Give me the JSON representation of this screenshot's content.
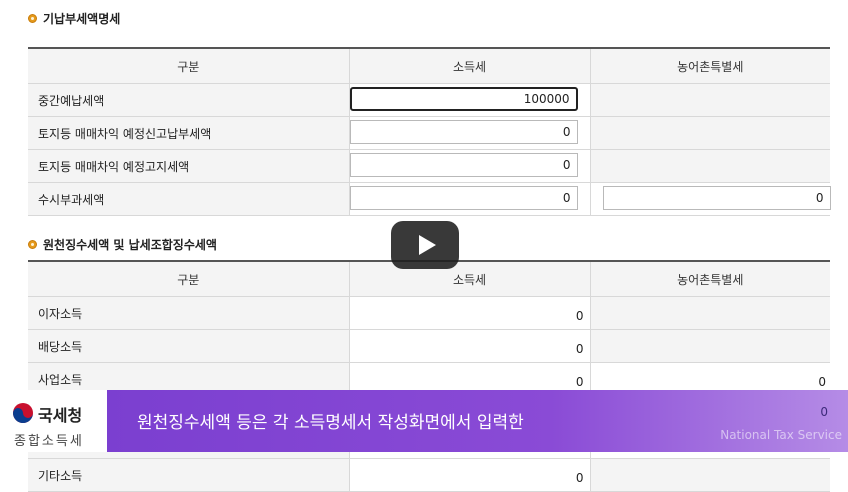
{
  "section1": {
    "title": "기납부세액명세",
    "headers": [
      "구분",
      "소득세",
      "농어촌특별세"
    ],
    "rows": [
      {
        "label": "중간예납세액",
        "income_tax": "100000"
      },
      {
        "label": "토지등 매매차익 예정신고납부세액",
        "income_tax": "0"
      },
      {
        "label": "토지등 매매차익 예정고지세액",
        "income_tax": "0"
      },
      {
        "label": "수시부과세액",
        "income_tax": "0",
        "rural_tax": "0"
      }
    ]
  },
  "section2": {
    "title": "원천징수세액 및 납세조합징수세액",
    "headers": [
      "구분",
      "소득세",
      "농어촌특별세"
    ],
    "rows": [
      {
        "label": "이자소득",
        "income_tax": "0"
      },
      {
        "label": "배당소득",
        "income_tax": "0"
      },
      {
        "label": "사업소득",
        "income_tax": "0",
        "rural_tax": "0"
      },
      {
        "label": "기타소득",
        "income_tax": "0"
      }
    ],
    "hidden_row_rural": "0"
  },
  "logo": {
    "name": "국세청",
    "sub": "종합소득세"
  },
  "banner": {
    "caption": "원천징수세액 등은 각 소득명세서 작성화면에서 입력한",
    "english": "National Tax Service"
  },
  "colors": {
    "accent_bullet": "#e59a1c",
    "banner": "#7b3fd0"
  }
}
